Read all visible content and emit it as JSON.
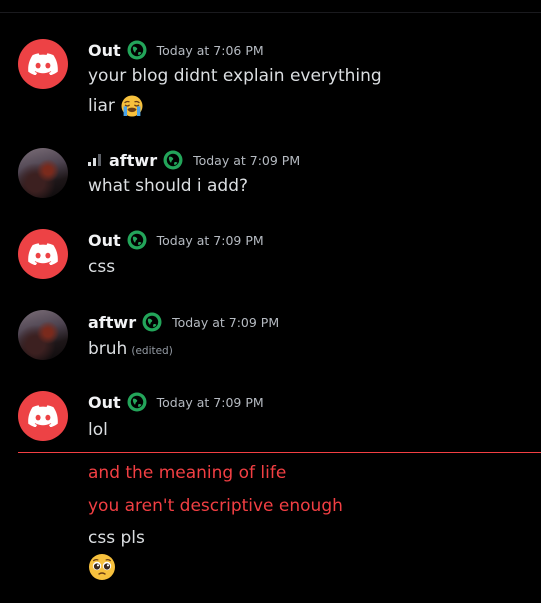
{
  "messages": [
    {
      "author": "Out",
      "timestamp": "Today at 7:06 PM",
      "lines": [
        "your blog didnt explain everything",
        "liar"
      ]
    },
    {
      "author": "aftwr",
      "timestamp": "Today at 7:09 PM",
      "lines": [
        "what should i add?"
      ]
    },
    {
      "author": "Out",
      "timestamp": "Today at 7:09 PM",
      "lines": [
        "css"
      ]
    },
    {
      "author": "aftwr",
      "timestamp": "Today at 7:09 PM",
      "lines": [
        "bruh"
      ],
      "edited": "(edited)"
    },
    {
      "author": "Out",
      "timestamp": "Today at 7:09 PM",
      "lines": [
        "lol"
      ]
    }
  ],
  "followups": [
    {
      "text": "and the meaning of life",
      "color": "#f23f43"
    },
    {
      "text": "you aren't descriptive enough",
      "color": "#f23f43"
    },
    {
      "text": "css pls",
      "color": "#dbdee1"
    }
  ],
  "icons": {
    "discord": "discord-logo-icon",
    "globe": "globe-icon",
    "signal": "signal-strength-icon",
    "cry": "loudly-crying-emoji",
    "pleading": "pleading-face-emoji"
  },
  "colors": {
    "discord_red": "#ed4245",
    "new_messages_line": "#f23f43",
    "globe_green": "#23a55a"
  }
}
